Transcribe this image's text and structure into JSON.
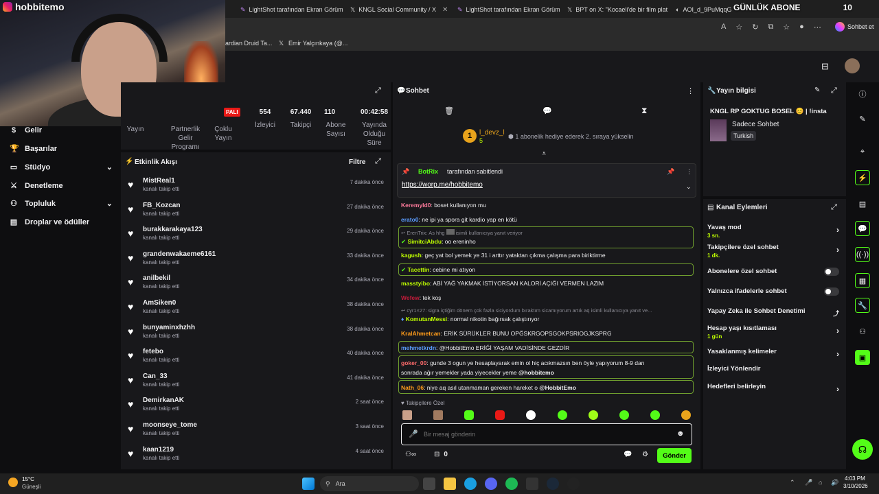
{
  "overlay": {
    "instagram": "hobbitemo",
    "sub_label": "GÜNLÜK ABONE",
    "sub_count": "10"
  },
  "browser": {
    "tabs": [
      {
        "title": "LightShot tarafından Ekran Görüm"
      },
      {
        "title": "KNGL Social Community / X"
      },
      {
        "title": "LightShot tarafından Ekran Görüm"
      },
      {
        "title": "BPT on X: \"Kocaeli'de bir film plat"
      },
      {
        "title": "AOI_d_9PuMqqGU"
      }
    ],
    "copilot": "Sohbet et",
    "bookmarks": [
      "ardian Druid Ta...",
      "Emir Yalçınkaya (@..."
    ]
  },
  "stats": {
    "badge": "PALI",
    "items": [
      {
        "value": "",
        "label": "Yayın"
      },
      {
        "value": "",
        "label": "Partnerlik Gelir Programı"
      },
      {
        "value": "",
        "label": "Çoklu Yayın"
      },
      {
        "value": "554",
        "label": "İzleyici"
      },
      {
        "value": "67.440",
        "label": "Takipçi"
      },
      {
        "value": "110",
        "label": "Abone Sayısı"
      },
      {
        "value": "00:42:58",
        "label": "Yayında Olduğu Süre"
      }
    ]
  },
  "nav": [
    {
      "label": "Gelir",
      "icon": "dollar-icon"
    },
    {
      "label": "Başarılar",
      "icon": "trophy-icon"
    },
    {
      "label": "Stüdyo",
      "icon": "studio-icon",
      "chevron": true
    },
    {
      "label": "Denetleme",
      "icon": "sword-icon"
    },
    {
      "label": "Topluluk",
      "icon": "community-icon",
      "chevron": true
    },
    {
      "label": "Droplar ve ödüller",
      "icon": "drops-icon"
    }
  ],
  "feed": {
    "title": "Etkinlik Akışı",
    "filter": "Filtre",
    "items": [
      {
        "name": "MistReal1",
        "desc": "kanalı takip etti",
        "time": "7 dakika önce"
      },
      {
        "name": "FB_Kozcan",
        "desc": "kanalı takip etti",
        "time": "27 dakika önce"
      },
      {
        "name": "burakkarakaya123",
        "desc": "kanalı takip etti",
        "time": "29 dakika önce"
      },
      {
        "name": "grandenwakaeme6161",
        "desc": "kanalı takip etti",
        "time": "33 dakika önce"
      },
      {
        "name": "anilbekil",
        "desc": "kanalı takip etti",
        "time": "34 dakika önce"
      },
      {
        "name": "AmSiken0",
        "desc": "kanalı takip etti",
        "time": "38 dakika önce"
      },
      {
        "name": "bunyaminxhzhh",
        "desc": "kanalı takip etti",
        "time": "38 dakika önce"
      },
      {
        "name": "fetebo",
        "desc": "kanalı takip etti",
        "time": "40 dakika önce"
      },
      {
        "name": "Can_33",
        "desc": "kanalı takip etti",
        "time": "41 dakika önce"
      },
      {
        "name": "DemirkanAK",
        "desc": "kanalı takip etti",
        "time": "2 saat önce"
      },
      {
        "name": "moonseye_tome",
        "desc": "kanalı takip etti",
        "time": "3 saat önce"
      },
      {
        "name": "kaan1219",
        "desc": "kanalı takip etti",
        "time": "4 saat önce"
      }
    ]
  },
  "chat": {
    "title": "Sohbet",
    "gift": {
      "user": "l_devz_l",
      "level": "5",
      "text": "1 abonelik hediye ederek 2. sıraya yükselin",
      "rank": "1"
    },
    "pinned": {
      "by": "BotRix",
      "suffix": "tarafından sabitlendi",
      "link": "https://worp.me/hobbitemo"
    },
    "messages": [
      {
        "user": "Keremyld0",
        "color": "#ff7b9c",
        "text": ": boset kullanıyon mu"
      },
      {
        "user": "erato0",
        "color": "#5a9cff",
        "text": ": ne ipi ya spora git kardio yap en kötü"
      },
      {
        "reply": "ErenTrix: As hhg",
        "reply2": "isimli kullanıcıya yanıt veriyor"
      },
      {
        "user": "SimitciAbdu",
        "color": "#bfff00",
        "text": ": oo ereninho"
      },
      {
        "user": "kagush",
        "color": "#bfff00",
        "text": ": geç yat bol yemek ye 31 i arttır yataktan çıkma çalışma para biriktirme"
      },
      {
        "user": "Tacettin",
        "color": "#bfff00",
        "text": ": cebine mi atıyon"
      },
      {
        "user": "masstyibo",
        "color": "#bfff00",
        "text": ": ABİ YAĞ YAKMAK İSTİYORSAN KALORİ AÇIĞI VERMEN LAZIM"
      },
      {
        "user": "Wefew",
        "color": "#c41b3a",
        "text": ": tek koş"
      },
      {
        "reply": "cyr1×27: sigra içtiğim dönem çok fazla siciyordum bıraktım sicamıyorum artık aq isimli kullanıcıya yanıt ve..."
      },
      {
        "user": "KomutanMessi",
        "color": "#bfff00",
        "text": ": normal nikotin bağırsak çalıştırıyor"
      },
      {
        "user": "KralAhmetcan",
        "color": "#ff9c1a",
        "text": ": ERİK SÜRÜKLER BUNU OPĞSKRGOPSGOKPSRIOGJKSPRG"
      },
      {
        "user": "mehmetkrdn",
        "color": "#5a9cff",
        "text": ": @HobbitEmo ERİĞİ YAŞAM VADİSİNDE GEZDİR"
      },
      {
        "user": "goker_00",
        "color": "#ff6b6b",
        "text": ": gunde 3 ogun ye hesaplayarak emin ol hiç acıkmazsın ben öyle yapıyorum 8-9 dan"
      },
      {
        "cont": "sonrada ağır yemekler yada yiyecekler yeme ",
        "mention": "@hobbitemo"
      },
      {
        "user": "Nath_06",
        "color": "#ff9c1a",
        "text": ": niye aq asıl utanmaman gereken hareket o ",
        "mention": "@HobbitEmo"
      }
    ],
    "followers_only": "Takipçilere Özel",
    "placeholder": "Bir mesaj gönderin",
    "points": "0",
    "send": "Gönder"
  },
  "info": {
    "title": "Yayın bilgisi",
    "stream_title": "KNGL RP GOKTUG BOSEL 😊 | !insta",
    "category": "Sadece Sohbet",
    "language": "Turkish"
  },
  "actions": {
    "title": "Kanal Eylemleri",
    "items": [
      {
        "label": "Yavaş mod",
        "sub": "3 sn.",
        "kind": "arrow"
      },
      {
        "label": "Takipçilere özel sohbet",
        "sub": "1 dk.",
        "kind": "arrow"
      },
      {
        "label": "Abonelere özel sohbet",
        "sub": "",
        "kind": "toggle"
      },
      {
        "label": "Yalnızca ifadelerle sohbet",
        "sub": "",
        "kind": "toggle"
      },
      {
        "label": "Yapay Zeka ile Sohbet Denetimi",
        "sub": "",
        "kind": "external"
      },
      {
        "label": "Hesap yaşı kısıtlaması",
        "sub": "1 gün",
        "kind": "arrow"
      },
      {
        "label": "Yasaklanmış kelimeler",
        "sub": "",
        "kind": "arrow"
      },
      {
        "label": "İzleyici Yönlendir",
        "sub": "",
        "kind": "none"
      },
      {
        "label": "Hedefleri belirleyin",
        "sub": "",
        "kind": "arrow"
      }
    ]
  },
  "taskbar": {
    "weather_temp": "15°C",
    "weather_desc": "Güneşli",
    "search": "Ara",
    "time": "4:03 PM",
    "date": "3/10/2026"
  },
  "colors": {
    "accent": "#53fc18",
    "panel": "#18181b",
    "bg": "#0e0e10"
  }
}
